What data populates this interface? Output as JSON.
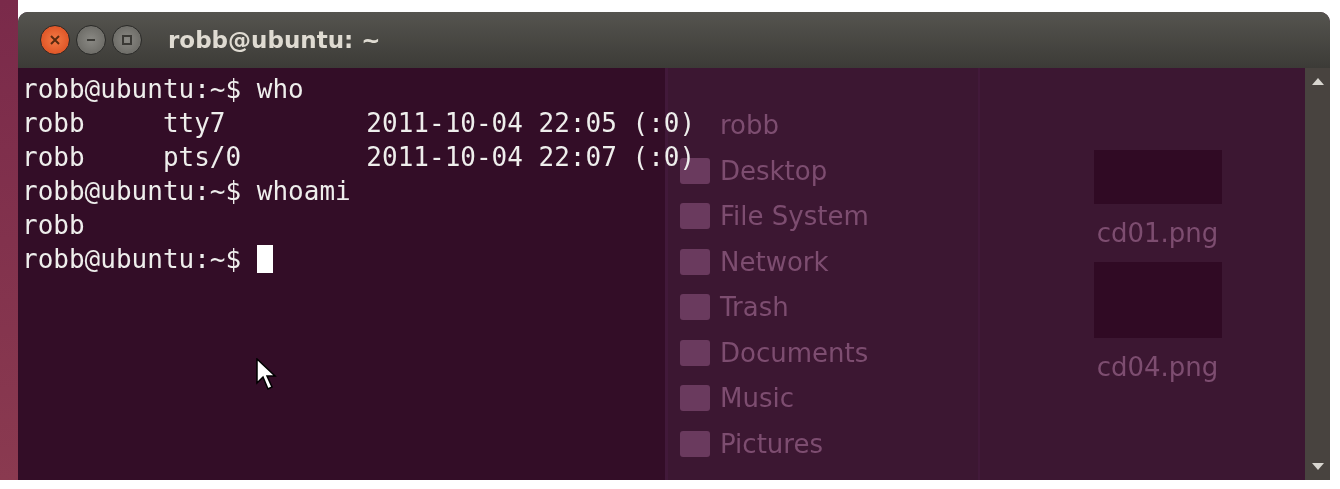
{
  "window": {
    "title": "robb@ubuntu: ~"
  },
  "terminal": {
    "lines": [
      "robb@ubuntu:~$ who",
      "robb     tty7         2011-10-04 22:05 (:0)",
      "robb     pts/0        2011-10-04 22:07 (:0)",
      "robb@ubuntu:~$ whoami",
      "robb",
      "robb@ubuntu:~$ "
    ]
  },
  "background_window": {
    "sidebar_items": [
      "robb",
      "Desktop",
      "File System",
      "Network",
      "Trash",
      "Documents",
      "Music",
      "Pictures"
    ],
    "files": [
      "cd01.png",
      "cd04.png"
    ]
  }
}
